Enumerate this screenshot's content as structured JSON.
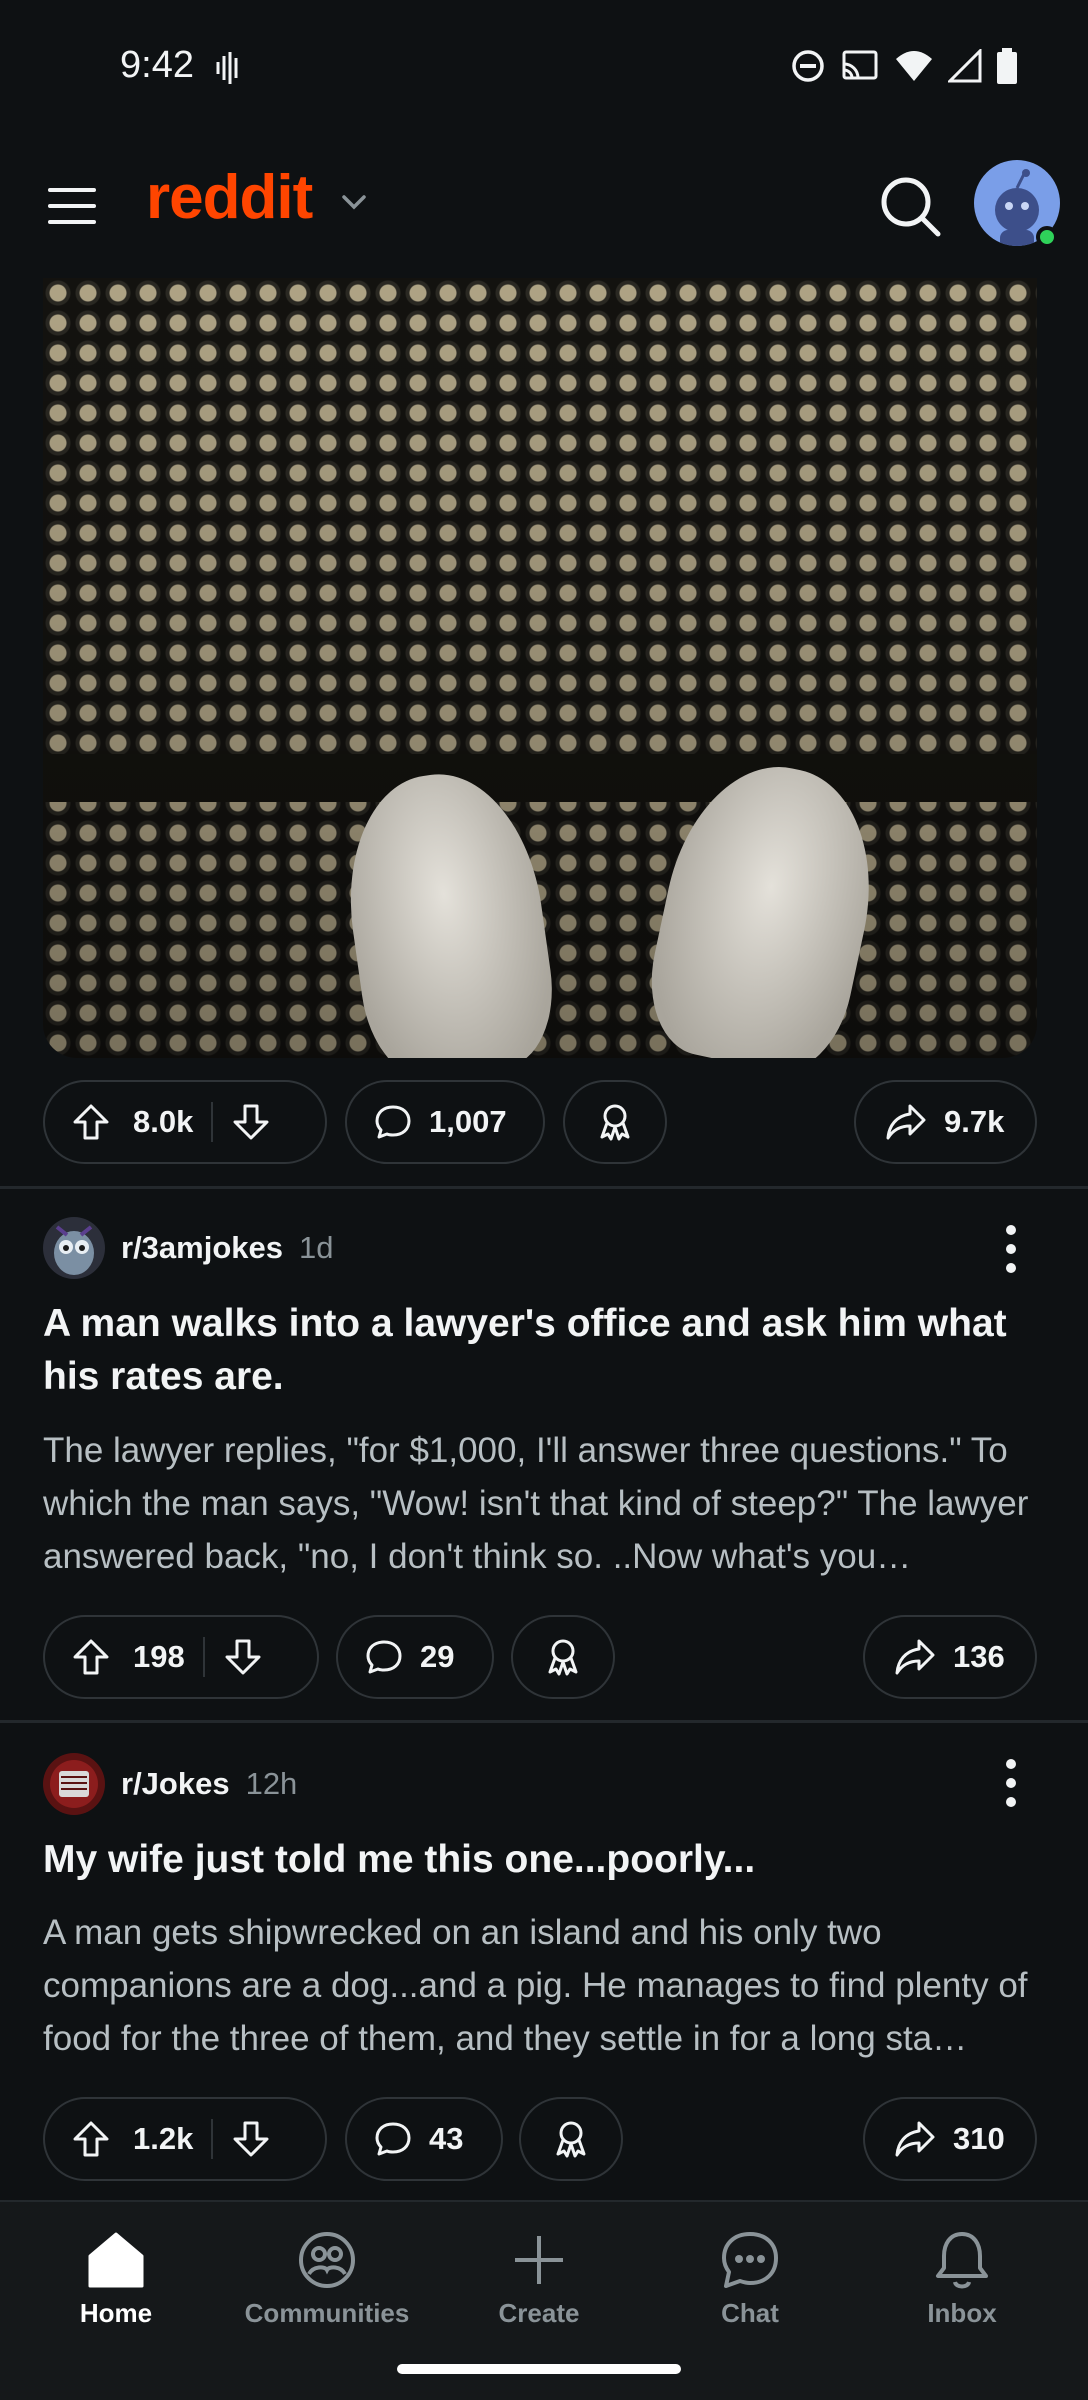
{
  "status_bar": {
    "time": "9:42"
  },
  "header": {
    "logo_text": "reddit",
    "brand_color": "#ff4500",
    "icons": [
      "menu-icon",
      "chevron-down-icon",
      "search-icon",
      "avatar"
    ]
  },
  "posts": [
    {
      "upvotes": "8.0k",
      "comments": "1,007",
      "shares": "9.7k"
    },
    {
      "subreddit": "r/3amjokes",
      "age": "1d",
      "title": "A man walks into a lawyer's office and ask him what his rates are.",
      "body": "The lawyer replies, \"for $1,000, I'll answer three questions.\" To which the man says, \"Wow! isn't that kind of steep?\" The lawyer answered back, \"no, I don't think so. ..Now what's you…",
      "upvotes": "198",
      "comments": "29",
      "shares": "136"
    },
    {
      "subreddit": "r/Jokes",
      "age": "12h",
      "title": "My wife just told me this one...poorly...",
      "body": "A man gets shipwrecked on an island and his only two companions are a dog...and a pig. He manages to find plenty of food for the three of them, and they settle in for a long sta…",
      "upvotes": "1.2k",
      "comments": "43",
      "shares": "310"
    }
  ],
  "bottom_nav": {
    "items": [
      {
        "label": "Home",
        "icon": "home-icon",
        "active": true
      },
      {
        "label": "Communities",
        "icon": "communities-icon"
      },
      {
        "label": "Create",
        "icon": "plus-icon"
      },
      {
        "label": "Chat",
        "icon": "chat-icon"
      },
      {
        "label": "Inbox",
        "icon": "bell-icon"
      }
    ]
  }
}
